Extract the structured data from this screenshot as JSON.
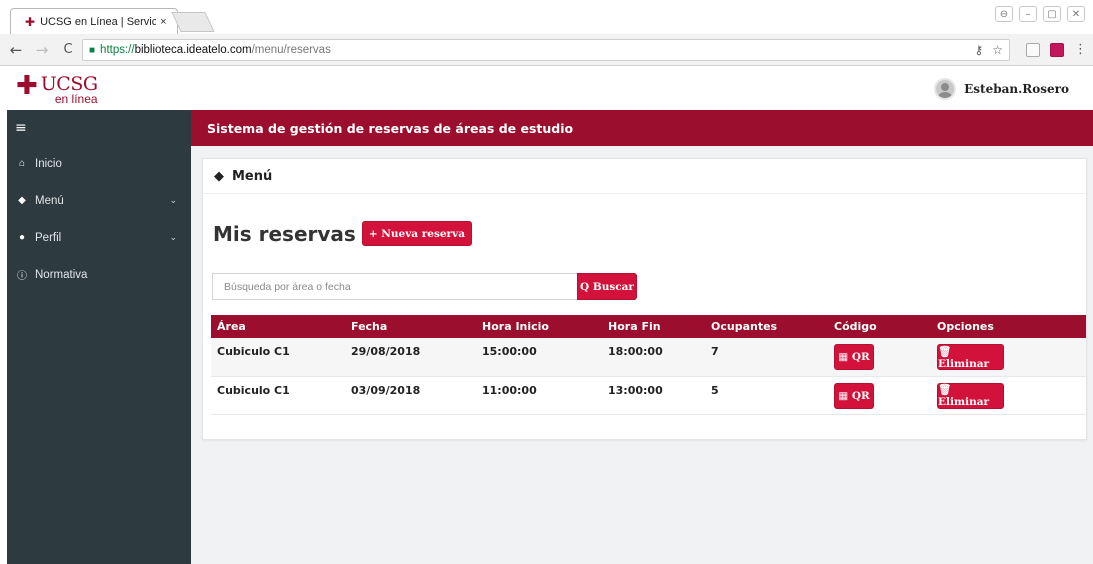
{
  "browser": {
    "tab_title": "UCSG en Línea | Servicios",
    "tab_close": "×",
    "url_secure": "https://",
    "url_host": "biblioteca.ideatelo.com",
    "url_path": "/menu/reservas",
    "back": "←",
    "forward": "→",
    "reload": "C"
  },
  "header": {
    "logo_main": "UCSG",
    "logo_sub": "en línea",
    "user_name": "Esteban.Rosero"
  },
  "sidebar": {
    "toggle": "≡",
    "items": [
      {
        "label": "Inicio",
        "icon": "home-icon"
      },
      {
        "label": "Menú",
        "icon": "graduation-cap-icon",
        "chevron": "⌄"
      },
      {
        "label": "Perfil",
        "icon": "user-icon",
        "chevron": "⌄"
      },
      {
        "label": "Normativa",
        "icon": "info-icon"
      }
    ]
  },
  "topbar": {
    "title": "Sistema de gestión de reservas de áreas de estudio"
  },
  "panel": {
    "title": "Menú"
  },
  "page": {
    "heading": "Mis reservas",
    "new_button": "+ Nueva reserva",
    "search_placeholder": "Búsqueda por área o fecha",
    "search_button": "Q Buscar"
  },
  "table": {
    "columns": [
      "Área",
      "Fecha",
      "Hora Inicio",
      "Hora Fin",
      "Ocupantes",
      "Código",
      "Opciones"
    ],
    "rows": [
      {
        "area": "Cubiculo C1",
        "fecha": "29/08/2018",
        "inicio": "15:00:00",
        "fin": "18:00:00",
        "ocupantes": "7",
        "qr": "▦ QR",
        "eliminar": "🗑 Eliminar"
      },
      {
        "area": "Cubiculo C1",
        "fecha": "03/09/2018",
        "inicio": "11:00:00",
        "fin": "13:00:00",
        "ocupantes": "5",
        "qr": "▦ QR",
        "eliminar": "🗑 Eliminar"
      }
    ]
  },
  "colors": {
    "brand": "#9b0e2d",
    "button": "#d2123a",
    "sidebar": "#2d3a40"
  }
}
